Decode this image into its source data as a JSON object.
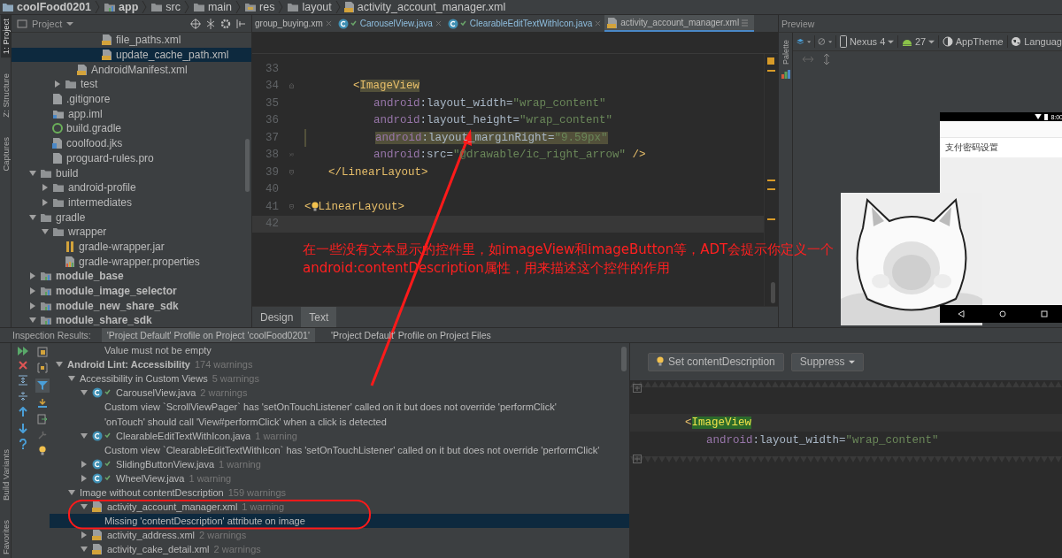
{
  "breadcrumbs": [
    {
      "label": "coolFood0201",
      "kind": "project"
    },
    {
      "label": "app",
      "kind": "module"
    },
    {
      "label": "src",
      "kind": "folder"
    },
    {
      "label": "main",
      "kind": "folder"
    },
    {
      "label": "res",
      "kind": "res"
    },
    {
      "label": "layout",
      "kind": "folder"
    },
    {
      "label": "activity_account_manager.xml",
      "kind": "xml"
    }
  ],
  "side_tools_top": [
    {
      "label": "1: Project",
      "selected": true
    },
    {
      "label": "Z: Structure",
      "selected": false
    },
    {
      "label": "Captures",
      "selected": false
    }
  ],
  "side_tools_bottom": [
    {
      "label": "Build Variants",
      "selected": false
    },
    {
      "label": "Favorites",
      "selected": false
    }
  ],
  "project_panel": {
    "title": "Project",
    "tree": [
      {
        "children": [
          {
            "children": [
              {
                "children": [
                  {
                    "children": [
                      {
                        "children": [
                          {
                            "label": "file_paths.xml",
                            "kind": "xml",
                            "selected": false
                          },
                          {
                            "label": "update_cache_path.xml",
                            "kind": "xml",
                            "selected": true
                          }
                        ]
                      }
                    ]
                  },
                  {
                    "label": "AndroidManifest.xml",
                    "kind": "manifest",
                    "selected": false
                  }
                ]
              },
              {
                "label": "test",
                "kind": "folder",
                "expanded": false,
                "selected": false
              }
            ]
          },
          {
            "label": ".gitignore",
            "kind": "text",
            "selected": false
          },
          {
            "label": "app.iml",
            "kind": "iml",
            "selected": false
          },
          {
            "label": "build.gradle",
            "kind": "gradle",
            "selected": false
          },
          {
            "label": "coolfood.jks",
            "kind": "keystore",
            "selected": false
          },
          {
            "label": "proguard-rules.pro",
            "kind": "text",
            "selected": false
          }
        ]
      },
      {
        "label": "build",
        "kind": "folder",
        "expanded": true,
        "selected": false,
        "children": [
          {
            "label": "android-profile",
            "kind": "folder",
            "expanded": false,
            "selected": false
          },
          {
            "label": "intermediates",
            "kind": "folder",
            "expanded": false,
            "selected": false
          }
        ]
      },
      {
        "label": "gradle",
        "kind": "folder",
        "expanded": true,
        "selected": false,
        "children": [
          {
            "label": "wrapper",
            "kind": "folder",
            "expanded": true,
            "selected": false,
            "children": [
              {
                "label": "gradle-wrapper.jar",
                "kind": "jar",
                "selected": false
              },
              {
                "label": "gradle-wrapper.properties",
                "kind": "properties",
                "selected": false
              }
            ]
          }
        ]
      },
      {
        "label": "module_base",
        "kind": "module",
        "expanded": false,
        "selected": false
      },
      {
        "label": "module_image_selector",
        "kind": "module",
        "expanded": false,
        "selected": false
      },
      {
        "label": "module_new_share_sdk",
        "kind": "module",
        "expanded": false,
        "selected": false
      },
      {
        "label": "module_share_sdk",
        "kind": "module",
        "expanded": true,
        "selected": false
      }
    ]
  },
  "editor": {
    "tabs": [
      {
        "label": "group_buying.xm",
        "kind": "partial",
        "selected": false
      },
      {
        "label": "CarouselView.java",
        "kind": "java",
        "selected": false
      },
      {
        "label": "ClearableEditTextWithIcon.java",
        "kind": "java",
        "selected": false
      },
      {
        "label": "activity_account_manager.xml",
        "kind": "xml",
        "selected": true
      }
    ],
    "lines": [
      {
        "number": "33",
        "kind": "root",
        "warning": false,
        "current": false
      },
      {
        "number": "34",
        "kind": "element",
        "gutter": [
          {
            "kind": "fold-start"
          }
        ],
        "warning": false,
        "current": false,
        "tokens": [
          {
            "text": "<",
            "kind": "punct"
          },
          {
            "text": "ImageView",
            "kind": "tag-match"
          }
        ]
      },
      {
        "number": "35",
        "kind": "attribute",
        "warning": false,
        "current": false,
        "tokens": [
          {
            "text": "android",
            "kind": "ns"
          },
          {
            "text": ":layout_width=",
            "kind": "plain"
          },
          {
            "text": "\"wrap_content\"",
            "kind": "value"
          }
        ]
      },
      {
        "number": "36",
        "kind": "attribute",
        "warning": false,
        "current": false,
        "tokens": [
          {
            "text": "android",
            "kind": "ns"
          },
          {
            "text": ":layout_height=",
            "kind": "plain"
          },
          {
            "text": "\"wrap_content\"",
            "kind": "value"
          }
        ]
      },
      {
        "number": "37",
        "kind": "attribute",
        "warning": true,
        "current": false,
        "tokens": [
          {
            "text": "android",
            "kind": "ns"
          },
          {
            "text": ":layout_marginRight=",
            "kind": "plain"
          },
          {
            "text": "\"9.59px\"",
            "kind": "value"
          }
        ]
      },
      {
        "number": "38",
        "kind": "attribute",
        "gutter": [
          {
            "kind": "chevron"
          },
          {
            "kind": "fold-end"
          }
        ],
        "warning": false,
        "current": false,
        "tokens": [
          {
            "text": "android",
            "kind": "ns"
          },
          {
            "text": ":src=",
            "kind": "plain"
          },
          {
            "text": "\"@drawable/ic_right_arrow\"",
            "kind": "value"
          },
          {
            "text": " />",
            "kind": "punct"
          }
        ]
      },
      {
        "number": "39",
        "kind": "close",
        "gutter": [
          {
            "kind": "fold-end"
          }
        ],
        "warning": false,
        "current": false,
        "tokens": [
          {
            "text": "</LinearLayout>",
            "kind": "tag"
          }
        ]
      },
      {
        "number": "40",
        "kind": "root",
        "warning": false,
        "current": false
      },
      {
        "number": "41",
        "kind": "root",
        "gutter": [
          {
            "kind": "fold-end"
          }
        ],
        "warning": false,
        "current": false,
        "tokens": [
          {
            "text": "<",
            "kind": "tag"
          },
          {
            "kind": "bulb"
          },
          {
            "text": "LinearLayout>",
            "kind": "tag"
          }
        ]
      },
      {
        "number": "42",
        "kind": "root",
        "warning": false,
        "current": true
      }
    ],
    "bottom_tabs": [
      {
        "label": "Design",
        "selected": false
      },
      {
        "label": "Text",
        "selected": true
      }
    ]
  },
  "annotation": {
    "text": "在一些没有文本显示的控件里，如imageView和imageButton等，ADT会提示你定义一个android:contentDescription属性，用来描述这个控件的作用"
  },
  "preview": {
    "title": "Preview",
    "palette_label": "Palette",
    "toolbar": [
      {
        "label": "Nexus 4",
        "kind": "device"
      },
      {
        "label": "27",
        "kind": "api"
      },
      {
        "label": "AppTheme",
        "kind": "theme"
      },
      {
        "label": "Languag",
        "kind": "language"
      }
    ],
    "phone": {
      "time": "8:00",
      "rows": [
        "支付密码设置"
      ]
    }
  },
  "inspection": {
    "label": "Inspection Results:",
    "tabs": [
      {
        "label": "'Project Default' Profile on Project 'coolFood0201'",
        "selected": true
      },
      {
        "label": "'Project Default' Profile on Project Files",
        "selected": false
      }
    ],
    "tree": [
      {
        "children": [
          {
            "children": [
              {
                "children": [
                  {
                    "label": "Value must not be empty",
                    "selected": false
                  }
                ]
              }
            ]
          }
        ]
      },
      {
        "label": "Android Lint: Accessibility",
        "count": "174 warnings",
        "kind": "group",
        "expanded": true,
        "selected": false,
        "children": [
          {
            "label": "Accessibility in Custom Views",
            "count": "5 warnings",
            "expanded": true,
            "selected": false,
            "children": [
              {
                "label": "CarouselView.java",
                "count": "2 warnings",
                "kind": "java",
                "expanded": true,
                "selected": false,
                "children": [
                  {
                    "label": "Custom view `ScrollViewPager` has 'setOnTouchListener' called on it but does not override 'performClick'",
                    "selected": false
                  },
                  {
                    "label": "'onTouch' should call 'View#performClick' when a click is detected",
                    "selected": false
                  }
                ]
              },
              {
                "label": "ClearableEditTextWithIcon.java",
                "count": "1 warning",
                "kind": "java",
                "expanded": true,
                "selected": false,
                "children": [
                  {
                    "label": "Custom view `ClearableEditTextWithIcon` has 'setOnTouchListener' called on it but does not override 'performClick'",
                    "selected": false
                  }
                ]
              },
              {
                "label": "SlidingButtonView.java",
                "count": "1 warning",
                "kind": "java",
                "expanded": false,
                "selected": false
              },
              {
                "label": "WheelView.java",
                "count": "1 warning",
                "kind": "java",
                "expanded": false,
                "selected": false
              }
            ]
          },
          {
            "label": "Image without contentDescription",
            "count": "159 warnings",
            "expanded": true,
            "selected": false,
            "children": [
              {
                "label": "activity_account_manager.xml",
                "count": "1 warning",
                "kind": "xml",
                "expanded": true,
                "selected": false,
                "children": [
                  {
                    "label": "Missing 'contentDescription' attribute on image",
                    "selected": true
                  }
                ]
              },
              {
                "label": "activity_address.xml",
                "count": "2 warnings",
                "kind": "xml",
                "expanded": false,
                "selected": false
              },
              {
                "label": "activity_cake_detail.xml",
                "count": "2 warnings",
                "kind": "xml",
                "expanded": true,
                "selected": false
              }
            ]
          }
        ]
      }
    ],
    "detail": {
      "buttons": [
        {
          "label": "Set contentDescription",
          "kind": "quickfix"
        },
        {
          "label": "Suppress",
          "kind": "dropdown"
        }
      ],
      "snippet": [
        {
          "kind": "element",
          "tokens": [
            {
              "text": "<",
              "kind": "punct"
            },
            {
              "text": "ImageView",
              "kind": "tag-found"
            }
          ]
        },
        {
          "kind": "attribute",
          "tokens": [
            {
              "text": "android",
              "kind": "ns"
            },
            {
              "text": ":layout_width=",
              "kind": "plain"
            },
            {
              "text": "\"wrap_content\"",
              "kind": "value"
            }
          ]
        }
      ]
    }
  }
}
